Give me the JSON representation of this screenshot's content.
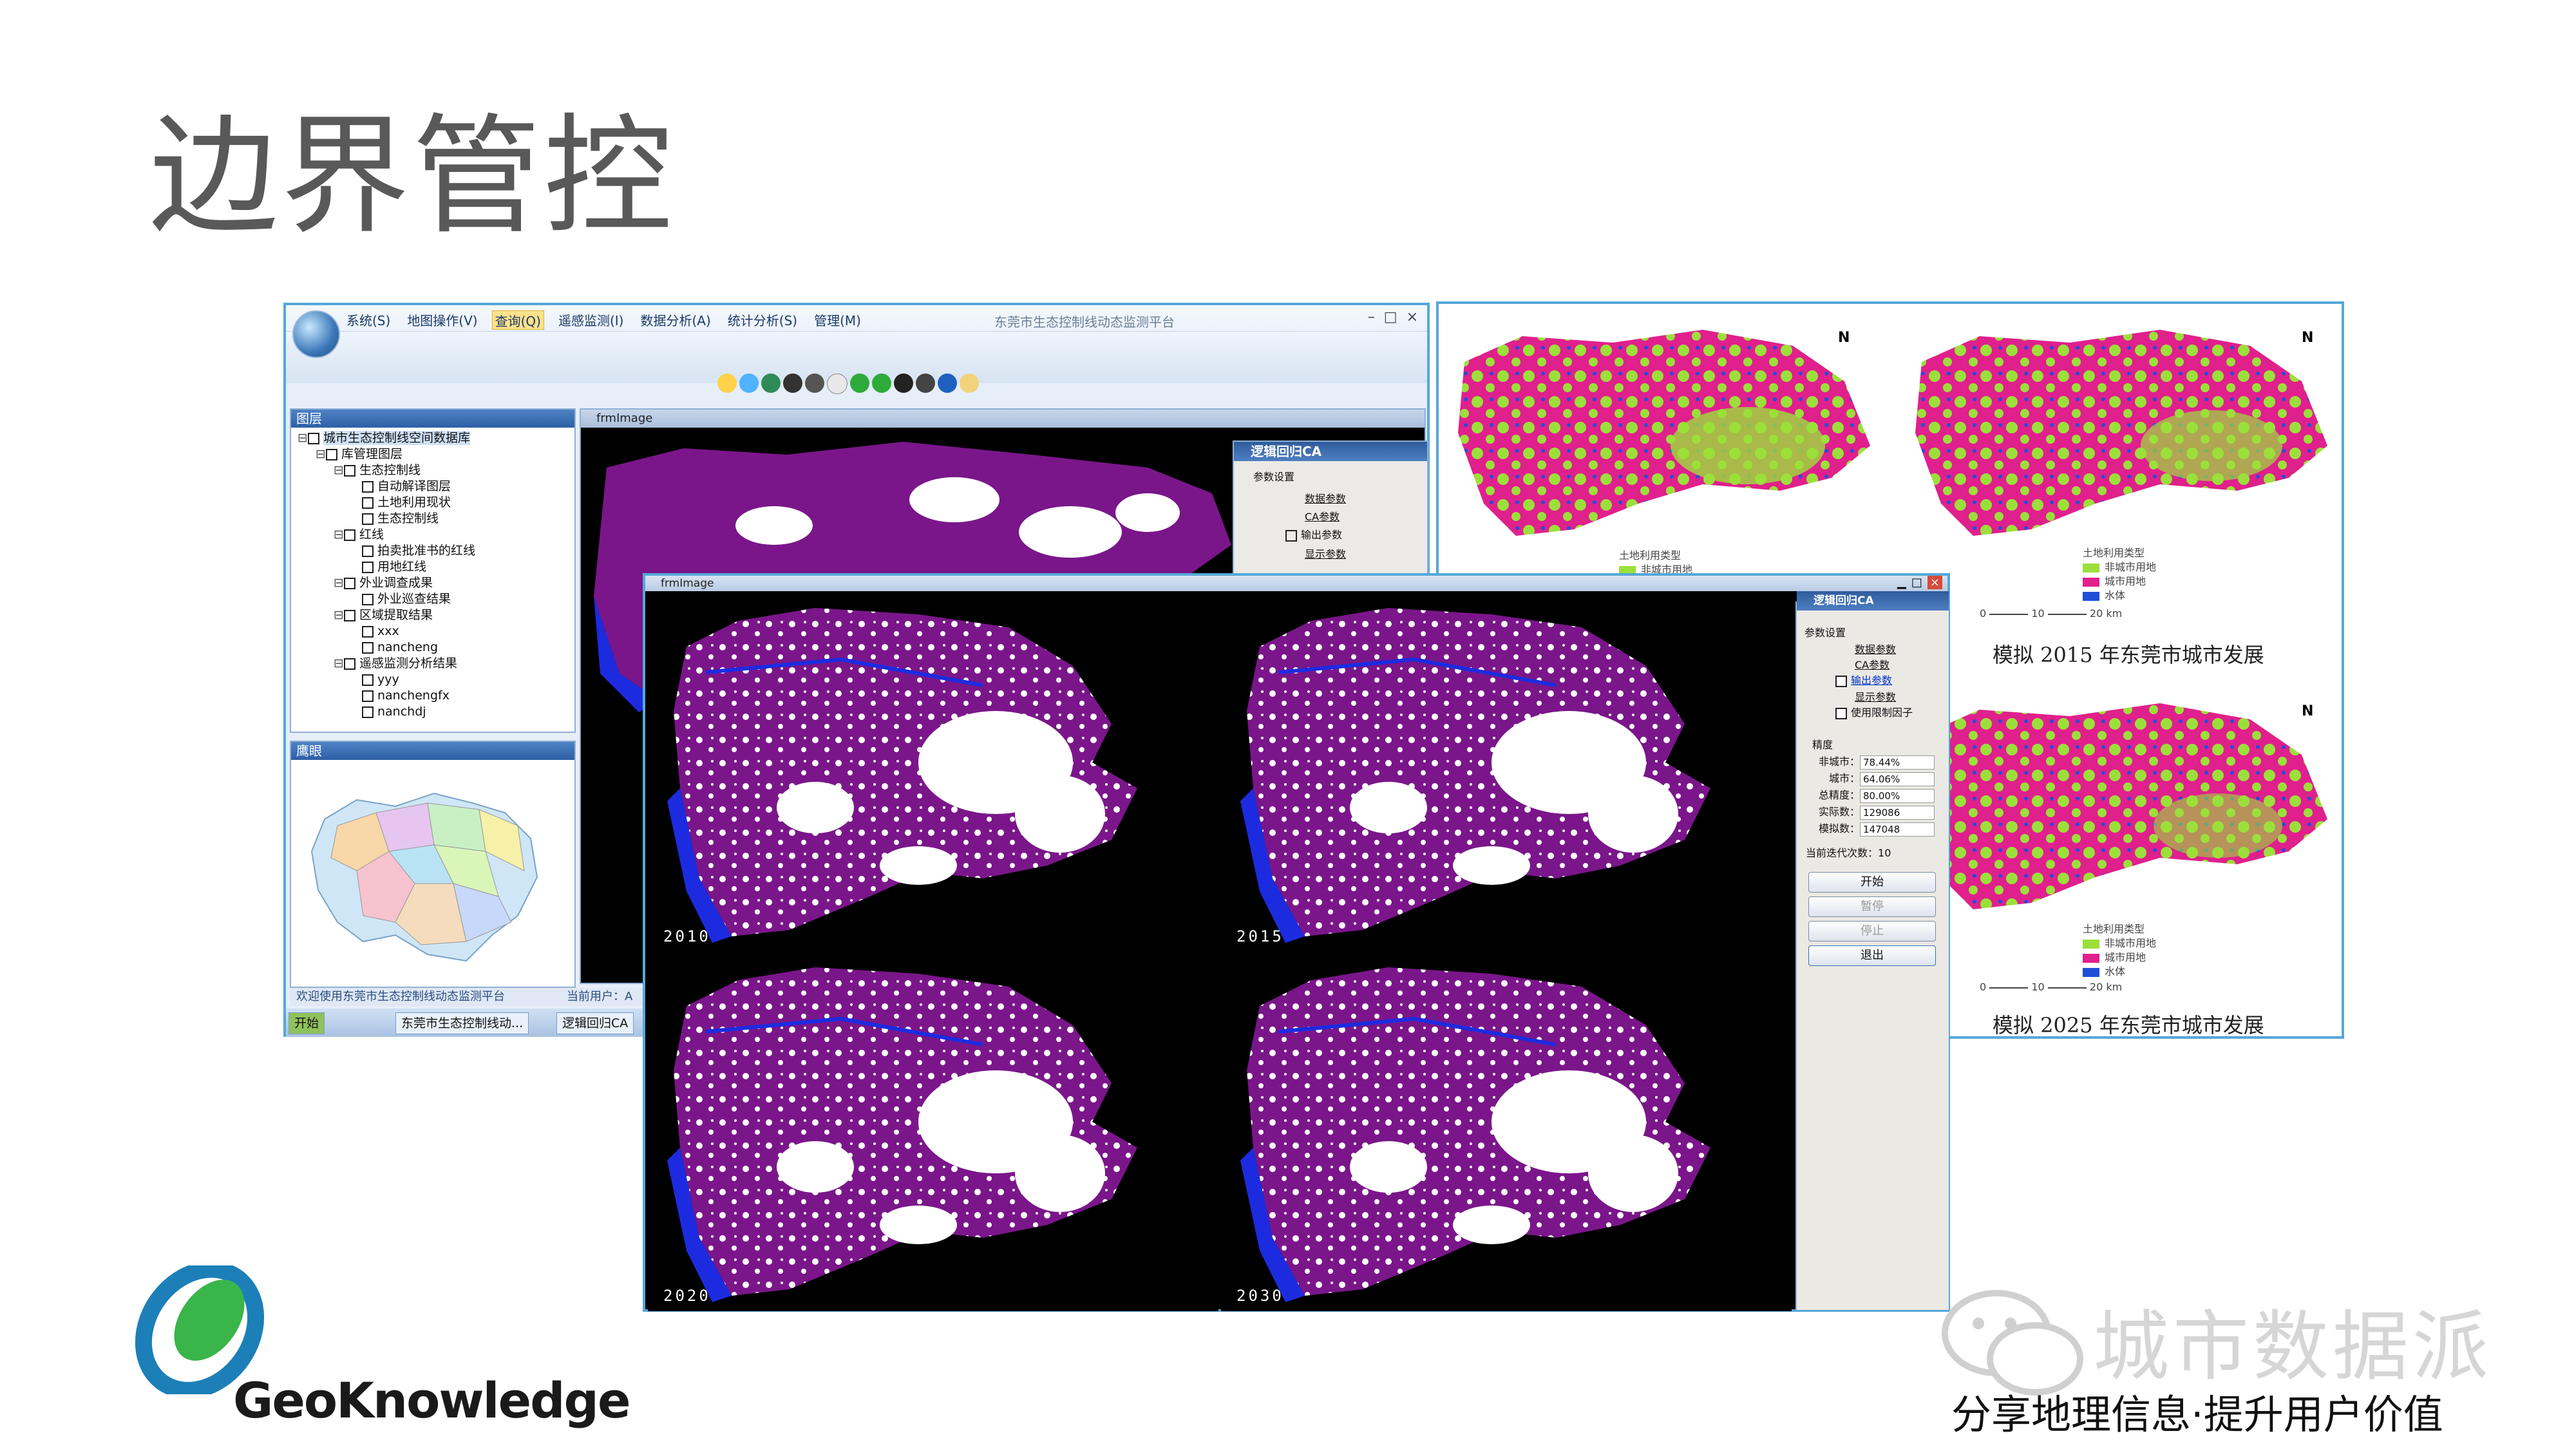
{
  "slide": {
    "title": "边界管控"
  },
  "app": {
    "window_title": "东莞市生态控制线动态监测平台",
    "menu": [
      "系统(S)",
      "地图操作(V)",
      "查询(Q)",
      "遥感监测(I)",
      "数据分析(A)",
      "统计分析(S)",
      "管理(M)"
    ],
    "active_menu": "查询(Q)",
    "window_buttons": [
      "–",
      "□",
      "×"
    ],
    "layers_panel": {
      "title": "图层",
      "tree": [
        {
          "label": "城市生态控制线空间数据库",
          "level": 0,
          "expander": "⊟"
        },
        {
          "label": "库管理图层",
          "level": 1,
          "expander": "⊟"
        },
        {
          "label": "生态控制线",
          "level": 2,
          "expander": "⊟"
        },
        {
          "label": "自动解译图层",
          "level": 3,
          "expander": ""
        },
        {
          "label": "土地利用现状",
          "level": 3,
          "expander": ""
        },
        {
          "label": "生态控制线",
          "level": 3,
          "expander": ""
        },
        {
          "label": "红线",
          "level": 2,
          "expander": "⊟"
        },
        {
          "label": "拍卖批准书的红线",
          "level": 3,
          "expander": ""
        },
        {
          "label": "用地红线",
          "level": 3,
          "expander": ""
        },
        {
          "label": "外业调查成果",
          "level": 2,
          "expander": "⊟"
        },
        {
          "label": "外业巡查结果",
          "level": 3,
          "expander": ""
        },
        {
          "label": "区域提取结果",
          "level": 2,
          "expander": "⊟"
        },
        {
          "label": "xxx",
          "level": 3,
          "expander": ""
        },
        {
          "label": "nancheng",
          "level": 3,
          "expander": ""
        },
        {
          "label": "遥感监测分析结果",
          "level": 2,
          "expander": "⊟"
        },
        {
          "label": "yyy",
          "level": 3,
          "expander": ""
        },
        {
          "label": "nanchengfx",
          "level": 3,
          "expander": ""
        },
        {
          "label": "nanchdj",
          "level": 3,
          "expander": ""
        }
      ]
    },
    "overview_panel": {
      "title": "鹰眼"
    },
    "status": {
      "welcome": "欢迎使用东莞市生态控制线动态监测平台",
      "user_label": "当前用户：A"
    },
    "taskbar": {
      "start": "开始",
      "items": [
        "东莞市生态控制线动...",
        "逻辑回归CA"
      ]
    },
    "frm_small": {
      "title": "frmImage",
      "ca_dialog": {
        "title": "逻辑回归CA",
        "group": "参数设置",
        "links": [
          "数据参数",
          "CA参数"
        ],
        "checkbox": "输出参数",
        "link_display": "显示参数"
      }
    }
  },
  "frm_big": {
    "title": "frmImage",
    "years": [
      "2010",
      "2015",
      "2020",
      "2030"
    ],
    "ca_dialog": {
      "title": "逻辑回归CA",
      "group": "参数设置",
      "link_data": "数据参数",
      "link_ca": "CA参数",
      "check_output": "输出参数",
      "link_display": "显示参数",
      "check_limit": "使用限制因子",
      "precision_group": "精度",
      "metrics": [
        {
          "label": "非城市：",
          "value": "78.44%"
        },
        {
          "label": "城市：",
          "value": "64.06%"
        },
        {
          "label": "总精度：",
          "value": "80.00%"
        },
        {
          "label": "实际数：",
          "value": "129086"
        },
        {
          "label": "模拟数：",
          "value": "147048"
        }
      ],
      "iteration_label": "当前迭代次数：",
      "iteration_value": "10",
      "buttons": {
        "start": "开始",
        "pause": "暂停",
        "stop": "停止",
        "exit": "退出"
      }
    }
  },
  "right_panel": {
    "captions": [
      "模拟 2015 年东莞市城市发展",
      "模拟 2025 年东莞市城市发展"
    ],
    "legend_title": "土地利用类型",
    "legend_items": [
      {
        "label": "非城市用地",
        "color": "#9be03a"
      },
      {
        "label": "城市用地",
        "color": "#e0208c"
      },
      {
        "label": "水体",
        "color": "#1f4fd8"
      }
    ],
    "north": "N",
    "scale": [
      "0",
      "10",
      "20 km"
    ]
  },
  "logo": {
    "text": "GeoKnowledge"
  },
  "watermark": {
    "name": "城市数据派",
    "slogan": "分享地理信息·提升用户价值"
  },
  "colors": {
    "urban": "#7a168a",
    "water": "#1d2be0",
    "nonurban": "#ffffff",
    "frame": "#56a8d8"
  }
}
